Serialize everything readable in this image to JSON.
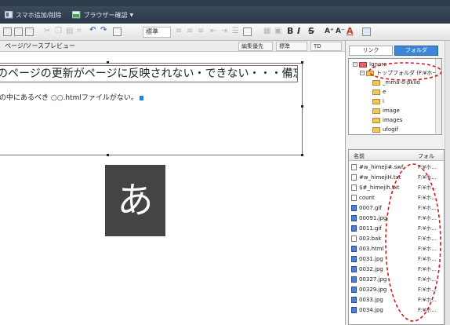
{
  "toolbar_top": {
    "add_sumaho": "スマホ追加/削除",
    "browser_check": "ブラウザー確認",
    "dropdown_arrow": "▼"
  },
  "toolbar_fmt": {
    "paragraph_select": "標準",
    "bold": "B",
    "italic": "I",
    "strike": "S",
    "font_grow": "A⁺",
    "font_shrink": "A⁻",
    "color_a": "A"
  },
  "view_bar": {
    "pagesource": "ページ/ソース",
    "preview": "プレビュー",
    "edit_priority": "編集優先",
    "standard": "標準",
    "td": "TD"
  },
  "editor": {
    "heading": "のページの更新がページに反映されない・できない・・・備忘録",
    "para": "の中にあるべき ○○.htmlファイルがない。",
    "glyph": "あ"
  },
  "panel": {
    "tab_link": "リンク",
    "tab_folder": "フォルダ",
    "tree": [
      "Ignore",
      "トップフォルダ (F:¥ホームペ",
      "_mma-o-pkiid",
      "e",
      "i",
      "image",
      "images",
      "ufogif"
    ],
    "columns": {
      "name": "名前",
      "folder": "フォル"
    },
    "files": [
      {
        "name": "#w_himeji#.swf",
        "path": "F:¥ホ..."
      },
      {
        "name": "#w_himejiH.txt",
        "path": "F:¥ホ..."
      },
      {
        "name": "$#_himejih.txt",
        "path": "F:¥ホ..."
      },
      {
        "name": "count",
        "path": "F:¥ホ..."
      },
      {
        "name": "0007.gif",
        "path": "F:¥ホ..."
      },
      {
        "name": "00091.jpg",
        "path": "F:¥ホ..."
      },
      {
        "name": "0011.gif",
        "path": "F:¥ホ..."
      },
      {
        "name": "003.bak",
        "path": "F:¥ホ..."
      },
      {
        "name": "003.html",
        "path": "F:¥ホ..."
      },
      {
        "name": "0031.jpg",
        "path": "F:¥ホ..."
      },
      {
        "name": "0032.jpg",
        "path": "F:¥ホ..."
      },
      {
        "name": "00327.jpg",
        "path": "F:¥ホ..."
      },
      {
        "name": "00329.jpg",
        "path": "F:¥ホ..."
      },
      {
        "name": "0033.jpg",
        "path": "F:¥ホ..."
      },
      {
        "name": "0034.jpg",
        "path": "F:¥ホ..."
      }
    ]
  },
  "colors": {
    "accent": "#2b7fd6",
    "annotation": "#d0191f"
  }
}
